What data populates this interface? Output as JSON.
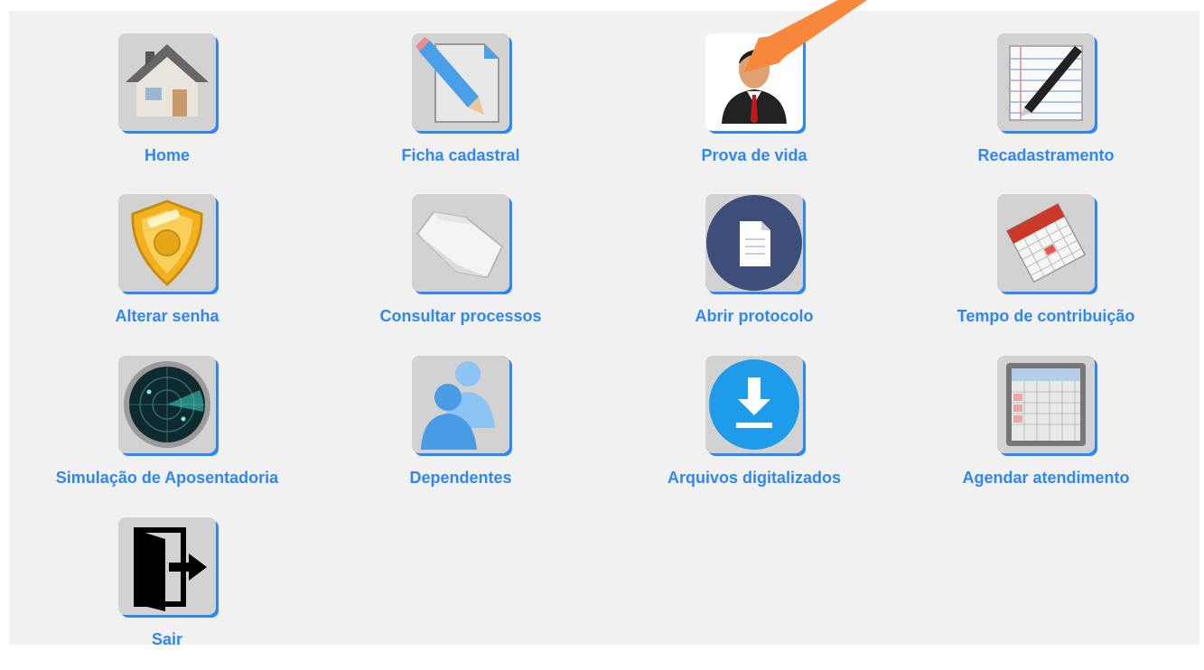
{
  "menu": {
    "items": [
      {
        "label": "Home",
        "icon": "house-icon"
      },
      {
        "label": "Ficha cadastral",
        "icon": "document-pencil-icon"
      },
      {
        "label": "Prova de vida",
        "icon": "businessman-icon"
      },
      {
        "label": "Recadastramento",
        "icon": "notepad-pen-icon"
      },
      {
        "label": "Alterar senha",
        "icon": "police-badge-icon"
      },
      {
        "label": "Consultar processos",
        "icon": "folder-icon"
      },
      {
        "label": "Abrir protocolo",
        "icon": "document-circle-icon"
      },
      {
        "label": "Tempo de contribuição",
        "icon": "calendar-icon"
      },
      {
        "label": "Simulação de Aposentadoria",
        "icon": "radar-icon"
      },
      {
        "label": "Dependentes",
        "icon": "users-icon"
      },
      {
        "label": "Arquivos digitalizados",
        "icon": "download-icon"
      },
      {
        "label": "Agendar atendimento",
        "icon": "schedule-calendar-icon"
      },
      {
        "label": "Sair",
        "icon": "exit-door-icon"
      }
    ]
  },
  "colors": {
    "accent": "#2f86f5",
    "panel_bg": "#f1f1f1",
    "arrow": "#f7873a"
  },
  "overlays": {
    "pointer_arrow": "orange-pointer-arrow-icon"
  }
}
